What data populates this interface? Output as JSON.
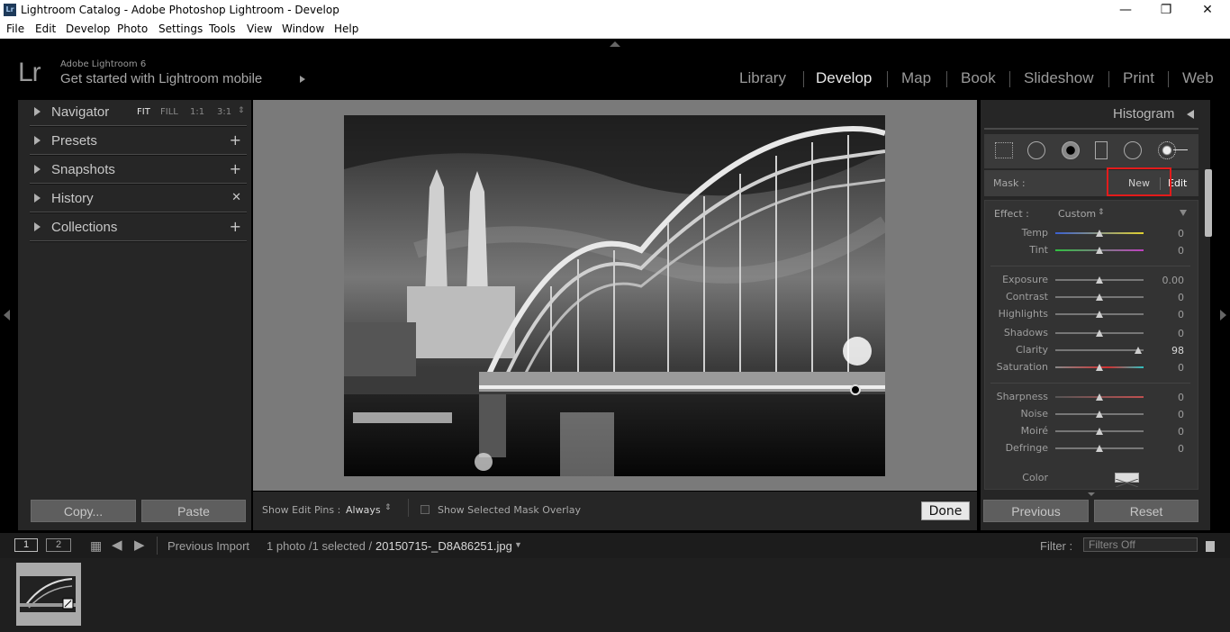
{
  "titlebar": {
    "title": "Lightroom Catalog - Adobe Photoshop Lightroom - Develop",
    "icon": "Lr",
    "minimize": "—",
    "maximize": "❐",
    "close": "✕"
  },
  "menu": [
    "File",
    "Edit",
    "Develop",
    "Photo",
    "Settings",
    "Tools",
    "View",
    "Window",
    "Help"
  ],
  "identity": {
    "logo": "Lr",
    "product": "Adobe Lightroom 6",
    "mobile": "Get started with Lightroom mobile"
  },
  "modules": [
    "Library",
    "Develop",
    "Map",
    "Book",
    "Slideshow",
    "Print",
    "Web"
  ],
  "active_module": "Develop",
  "left_panel": {
    "navigator": "Navigator",
    "nav_options": [
      "FIT",
      "FILL",
      "1:1",
      "3:1"
    ],
    "panels": [
      {
        "label": "Presets",
        "action": "+"
      },
      {
        "label": "Snapshots",
        "action": "+"
      },
      {
        "label": "History",
        "action": "✕"
      },
      {
        "label": "Collections",
        "action": "+"
      }
    ],
    "copy_button": "Copy...",
    "paste_button": "Paste"
  },
  "toolbar": {
    "edit_pins_label": "Show Edit Pins :",
    "edit_pins_value": "Always",
    "mask_overlay_label": "Show Selected Mask Overlay",
    "done": "Done"
  },
  "right_panel": {
    "histogram": "Histogram",
    "mask_label": "Mask :",
    "mask_new": "New",
    "mask_edit": "Edit",
    "effect_label": "Effect :",
    "effect_value": "Custom",
    "sliders": [
      {
        "label": "Temp",
        "value": "0",
        "pos": 0.5
      },
      {
        "label": "Tint",
        "value": "0",
        "pos": 0.5
      },
      {
        "label": "Exposure",
        "value": "0.00",
        "pos": 0.5
      },
      {
        "label": "Contrast",
        "value": "0",
        "pos": 0.5
      },
      {
        "label": "Highlights",
        "value": "0",
        "pos": 0.5
      },
      {
        "label": "Shadows",
        "value": "0",
        "pos": 0.5
      },
      {
        "label": "Clarity",
        "value": "98",
        "pos": 0.94
      },
      {
        "label": "Saturation",
        "value": "0",
        "pos": 0.5
      },
      {
        "label": "Sharpness",
        "value": "0",
        "pos": 0.5
      },
      {
        "label": "Noise",
        "value": "0",
        "pos": 0.5
      },
      {
        "label": "Moiré",
        "value": "0",
        "pos": 0.5
      },
      {
        "label": "Defringe",
        "value": "0",
        "pos": 0.5
      }
    ],
    "color_label": "Color",
    "previous_button": "Previous",
    "reset_button": "Reset"
  },
  "filmstrip": {
    "view1": "1",
    "view2": "2",
    "source": "Previous Import",
    "count": "1 photo /1 selected /",
    "filename": "20150715-_D8A86251.jpg",
    "filter_label": "Filter :",
    "filter_value": "Filters Off"
  },
  "colors": {
    "highlight_box": "#e31b1b",
    "panel_bg": "#262626",
    "canvas_bg": "#7a7a7a"
  }
}
